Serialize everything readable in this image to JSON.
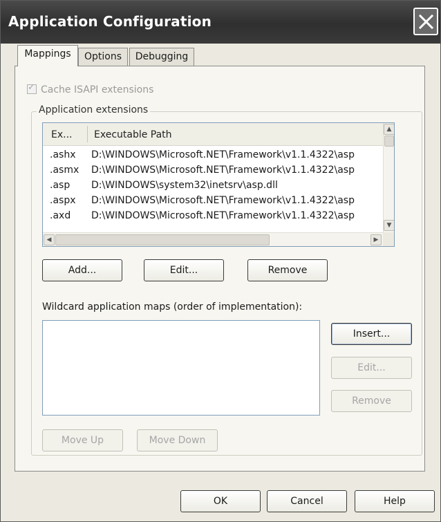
{
  "window": {
    "title": "Application Configuration"
  },
  "tabs": [
    {
      "label": "Mappings",
      "active": true
    },
    {
      "label": "Options",
      "active": false
    },
    {
      "label": "Debugging",
      "active": false
    }
  ],
  "cache_isapi": {
    "label": "Cache ISAPI extensions",
    "checked": true,
    "enabled": false
  },
  "app_extensions": {
    "group_label": "Application extensions",
    "columns": [
      "Ex...",
      "Executable Path"
    ],
    "rows": [
      {
        "ext": ".ashx",
        "path": "D:\\WINDOWS\\Microsoft.NET\\Framework\\v1.1.4322\\asp"
      },
      {
        "ext": ".asmx",
        "path": "D:\\WINDOWS\\Microsoft.NET\\Framework\\v1.1.4322\\asp"
      },
      {
        "ext": ".asp",
        "path": "D:\\WINDOWS\\system32\\inetsrv\\asp.dll"
      },
      {
        "ext": ".aspx",
        "path": "D:\\WINDOWS\\Microsoft.NET\\Framework\\v1.1.4322\\asp"
      },
      {
        "ext": ".axd",
        "path": "D:\\WINDOWS\\Microsoft.NET\\Framework\\v1.1.4322\\asp"
      }
    ],
    "buttons": {
      "add": "Add...",
      "edit": "Edit...",
      "remove": "Remove"
    }
  },
  "wildcard": {
    "label": "Wildcard application maps (order of implementation):",
    "buttons": {
      "insert": "Insert...",
      "edit": "Edit...",
      "remove": "Remove",
      "move_up": "Move Up",
      "move_down": "Move Down"
    }
  },
  "footer": {
    "ok": "OK",
    "cancel": "Cancel",
    "help": "Help"
  },
  "icons": {
    "close": "close-icon",
    "scroll_up": "scroll-up-icon",
    "scroll_down": "scroll-down-icon",
    "scroll_left": "scroll-left-icon",
    "scroll_right": "scroll-right-icon"
  }
}
